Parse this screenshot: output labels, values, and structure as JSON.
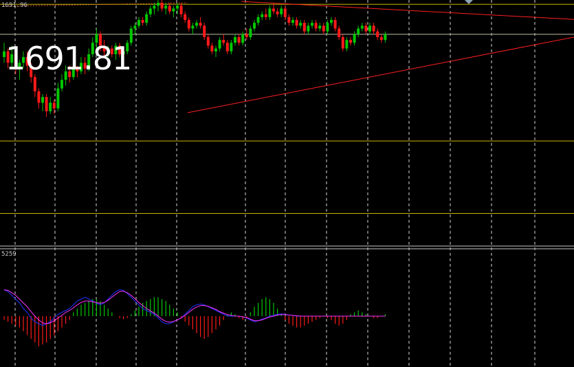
{
  "header": {
    "price_display": "1691.81",
    "top_price_label": "1691.96",
    "indicator_label": "5259"
  },
  "colors": {
    "background": "#000000",
    "bull": "#00c800",
    "bear": "#ff1a1a",
    "trendline": "#ff2020",
    "level": "#c8b400",
    "grid": "#ffffff",
    "macd_line": "#2233ff",
    "signal_line": "#ff33ff"
  },
  "chart_data": [
    {
      "type": "candlestick",
      "title": "",
      "grid": true,
      "x_count": 120,
      "ylim": [
        1608,
        1694
      ],
      "candles": [
        [
          1674,
          1679,
          1672,
          1676
        ],
        [
          1676,
          1677,
          1670,
          1672
        ],
        [
          1672,
          1678,
          1670,
          1675
        ],
        [
          1675,
          1676,
          1668,
          1670
        ],
        [
          1670,
          1673,
          1666,
          1672
        ],
        [
          1672,
          1676,
          1670,
          1674
        ],
        [
          1674,
          1676,
          1669,
          1671
        ],
        [
          1671,
          1672,
          1665,
          1667
        ],
        [
          1667,
          1668,
          1660,
          1662
        ],
        [
          1662,
          1663,
          1656,
          1658
        ],
        [
          1658,
          1661,
          1655,
          1660
        ],
        [
          1660,
          1661,
          1653,
          1655
        ],
        [
          1655,
          1660,
          1654,
          1658
        ],
        [
          1658,
          1659,
          1654,
          1656
        ],
        [
          1656,
          1665,
          1655,
          1663
        ],
        [
          1663,
          1668,
          1662,
          1666
        ],
        [
          1666,
          1671,
          1664,
          1669
        ],
        [
          1669,
          1671,
          1665,
          1667
        ],
        [
          1667,
          1671,
          1666,
          1670
        ],
        [
          1670,
          1671,
          1667,
          1669
        ],
        [
          1669,
          1674,
          1668,
          1672
        ],
        [
          1672,
          1674,
          1668,
          1670
        ],
        [
          1670,
          1677,
          1669,
          1675
        ],
        [
          1675,
          1681,
          1674,
          1679
        ],
        [
          1679,
          1684,
          1677,
          1682
        ],
        [
          1682,
          1683,
          1676,
          1678
        ],
        [
          1678,
          1680,
          1674,
          1676
        ],
        [
          1676,
          1678,
          1674,
          1677
        ],
        [
          1677,
          1678,
          1674,
          1675
        ],
        [
          1675,
          1679,
          1673,
          1678
        ],
        [
          1678,
          1679,
          1674,
          1675
        ],
        [
          1675,
          1677,
          1673,
          1676
        ],
        [
          1676,
          1680,
          1675,
          1679
        ],
        [
          1679,
          1685,
          1678,
          1684
        ],
        [
          1684,
          1686,
          1682,
          1685
        ],
        [
          1685,
          1688,
          1684,
          1687
        ],
        [
          1687,
          1688,
          1685,
          1686
        ],
        [
          1686,
          1690,
          1685,
          1689
        ],
        [
          1689,
          1692,
          1688,
          1691
        ],
        [
          1691,
          1693,
          1689,
          1692
        ],
        [
          1692,
          1694,
          1690,
          1693
        ],
        [
          1693,
          1694,
          1690,
          1691
        ],
        [
          1691,
          1693,
          1689,
          1692
        ],
        [
          1692,
          1693,
          1689,
          1690
        ],
        [
          1690,
          1692,
          1688,
          1691
        ],
        [
          1691,
          1693,
          1689,
          1692
        ],
        [
          1692,
          1693,
          1688,
          1689
        ],
        [
          1689,
          1690,
          1686,
          1687
        ],
        [
          1687,
          1688,
          1683,
          1684
        ],
        [
          1684,
          1686,
          1682,
          1685
        ],
        [
          1685,
          1687,
          1684,
          1686
        ],
        [
          1686,
          1688,
          1684,
          1685
        ],
        [
          1685,
          1686,
          1680,
          1681
        ],
        [
          1681,
          1682,
          1677,
          1678
        ],
        [
          1678,
          1679,
          1675,
          1676
        ],
        [
          1676,
          1678,
          1674,
          1677
        ],
        [
          1677,
          1681,
          1676,
          1680
        ],
        [
          1680,
          1682,
          1678,
          1679
        ],
        [
          1679,
          1680,
          1675,
          1676
        ],
        [
          1676,
          1680,
          1675,
          1679
        ],
        [
          1679,
          1682,
          1678,
          1681
        ],
        [
          1681,
          1682,
          1678,
          1679
        ],
        [
          1679,
          1683,
          1678,
          1682
        ],
        [
          1682,
          1684,
          1680,
          1681
        ],
        [
          1681,
          1685,
          1680,
          1684
        ],
        [
          1684,
          1687,
          1683,
          1686
        ],
        [
          1686,
          1689,
          1685,
          1688
        ],
        [
          1688,
          1690,
          1687,
          1689
        ],
        [
          1689,
          1691,
          1687,
          1688
        ],
        [
          1688,
          1692,
          1687,
          1691
        ],
        [
          1691,
          1693,
          1689,
          1690
        ],
        [
          1690,
          1691,
          1688,
          1689
        ],
        [
          1689,
          1692,
          1688,
          1691
        ],
        [
          1691,
          1692,
          1687,
          1688
        ],
        [
          1688,
          1689,
          1685,
          1686
        ],
        [
          1686,
          1688,
          1685,
          1687
        ],
        [
          1687,
          1688,
          1684,
          1685
        ],
        [
          1685,
          1687,
          1684,
          1686
        ],
        [
          1686,
          1687,
          1682,
          1683
        ],
        [
          1683,
          1686,
          1682,
          1685
        ],
        [
          1685,
          1687,
          1684,
          1686
        ],
        [
          1686,
          1687,
          1683,
          1684
        ],
        [
          1684,
          1686,
          1683,
          1685
        ],
        [
          1685,
          1686,
          1682,
          1683
        ],
        [
          1683,
          1687,
          1682,
          1686
        ],
        [
          1686,
          1688,
          1685,
          1687
        ],
        [
          1687,
          1688,
          1683,
          1684
        ],
        [
          1684,
          1685,
          1680,
          1681
        ],
        [
          1681,
          1682,
          1676,
          1677
        ],
        [
          1677,
          1681,
          1676,
          1680
        ],
        [
          1680,
          1681,
          1678,
          1679
        ],
        [
          1679,
          1683,
          1678,
          1682
        ],
        [
          1682,
          1685,
          1681,
          1684
        ],
        [
          1684,
          1686,
          1683,
          1685
        ],
        [
          1685,
          1686,
          1682,
          1683
        ],
        [
          1683,
          1686,
          1682,
          1685
        ],
        [
          1685,
          1686,
          1682,
          1683
        ],
        [
          1683,
          1684,
          1680,
          1681
        ],
        [
          1681,
          1682,
          1679,
          1680
        ],
        [
          1680,
          1683,
          1679,
          1682
        ]
      ],
      "support_line": {
        "from": [
          48,
          1654.5
        ],
        "to": [
          120,
          1681.0
        ]
      },
      "resistance_line": {
        "from": [
          62,
          1693.5
        ],
        "to": [
          120,
          1687.2
        ]
      },
      "horizontal_levels": [
        1692.5,
        1682.0,
        1644.6,
        1619.2
      ],
      "faint_line": {
        "from": [
          0,
          1691.8
        ],
        "to": [
          48,
          1693.0
        ]
      },
      "current_price_line": 1682.0
    },
    {
      "type": "macd",
      "title": "",
      "grid": true,
      "ylim": [
        -1.0,
        1.0
      ],
      "histogram": [
        -0.1,
        -0.15,
        -0.2,
        -0.25,
        -0.3,
        -0.4,
        -0.5,
        -0.6,
        -0.7,
        -0.8,
        -0.75,
        -0.7,
        -0.6,
        -0.5,
        -0.4,
        -0.3,
        -0.2,
        -0.1,
        0.1,
        0.2,
        0.3,
        0.35,
        0.4,
        0.45,
        0.45,
        0.4,
        0.3,
        0.2,
        0.1,
        0.0,
        -0.05,
        -0.08,
        -0.05,
        0.05,
        0.15,
        0.25,
        0.35,
        0.4,
        0.45,
        0.5,
        0.5,
        0.45,
        0.4,
        0.3,
        0.2,
        0.1,
        -0.05,
        -0.15,
        -0.25,
        -0.35,
        -0.45,
        -0.55,
        -0.6,
        -0.55,
        -0.45,
        -0.35,
        -0.25,
        -0.1,
        0.05,
        0.1,
        0.05,
        -0.05,
        -0.1,
        -0.05,
        0.1,
        0.25,
        0.35,
        0.45,
        0.5,
        0.45,
        0.35,
        0.2,
        0.05,
        -0.1,
        -0.2,
        -0.25,
        -0.3,
        -0.3,
        -0.25,
        -0.2,
        -0.15,
        -0.1,
        -0.05,
        0.0,
        -0.05,
        -0.1,
        -0.2,
        -0.25,
        -0.2,
        -0.1,
        0.05,
        0.1,
        0.15,
        0.1,
        0.05,
        0.0,
        -0.05,
        -0.05,
        0.0,
        0.05
      ],
      "macd_line": [
        0.7,
        0.65,
        0.55,
        0.45,
        0.35,
        0.2,
        0.1,
        -0.05,
        -0.15,
        -0.2,
        -0.25,
        -0.2,
        -0.15,
        -0.05,
        0.05,
        0.1,
        0.15,
        0.2,
        0.3,
        0.4,
        0.45,
        0.5,
        0.45,
        0.4,
        0.35,
        0.3,
        0.35,
        0.45,
        0.55,
        0.65,
        0.7,
        0.68,
        0.6,
        0.5,
        0.4,
        0.3,
        0.2,
        0.15,
        0.1,
        0.05,
        -0.05,
        -0.15,
        -0.2,
        -0.2,
        -0.15,
        -0.1,
        -0.05,
        0.05,
        0.15,
        0.25,
        0.3,
        0.32,
        0.3,
        0.25,
        0.2,
        0.15,
        0.1,
        0.05,
        0.0,
        0.0,
        0.0,
        0.0,
        -0.02,
        -0.05,
        -0.1,
        -0.15,
        -0.12,
        -0.08,
        -0.05,
        0.0,
        0.02,
        0.05,
        0.06,
        0.05,
        0.03,
        0.02,
        0.0,
        0.0,
        0.0,
        0.0,
        0.0,
        0.0,
        0.0,
        0.0,
        0.0,
        0.0,
        0.0,
        0.0,
        0.0,
        0.0,
        0.0,
        0.0,
        0.0,
        0.0,
        0.0,
        0.0,
        0.0,
        0.0,
        0.0,
        0.0
      ],
      "signal_line": [
        0.7,
        0.68,
        0.62,
        0.55,
        0.45,
        0.35,
        0.25,
        0.12,
        0.0,
        -0.1,
        -0.18,
        -0.2,
        -0.18,
        -0.12,
        -0.05,
        0.02,
        0.1,
        0.15,
        0.22,
        0.3,
        0.36,
        0.4,
        0.4,
        0.38,
        0.36,
        0.34,
        0.36,
        0.42,
        0.5,
        0.58,
        0.65,
        0.66,
        0.62,
        0.55,
        0.46,
        0.36,
        0.28,
        0.2,
        0.14,
        0.08,
        0.0,
        -0.08,
        -0.14,
        -0.16,
        -0.14,
        -0.1,
        -0.05,
        0.02,
        0.1,
        0.18,
        0.24,
        0.28,
        0.28,
        0.26,
        0.22,
        0.18,
        0.12,
        0.08,
        0.04,
        0.02,
        0.0,
        0.0,
        -0.02,
        -0.04,
        -0.08,
        -0.12,
        -0.12,
        -0.1,
        -0.06,
        -0.02,
        0.0,
        0.03,
        0.04,
        0.04,
        0.03,
        0.02,
        0.01,
        0.0,
        0.0,
        0.0,
        0.0,
        0.0,
        0.0,
        0.0,
        0.0,
        0.0,
        0.0,
        0.0,
        0.0,
        0.0,
        0.0,
        0.0,
        0.0,
        0.0,
        0.0,
        0.0,
        0.0,
        0.0,
        0.0,
        0.0
      ]
    }
  ]
}
